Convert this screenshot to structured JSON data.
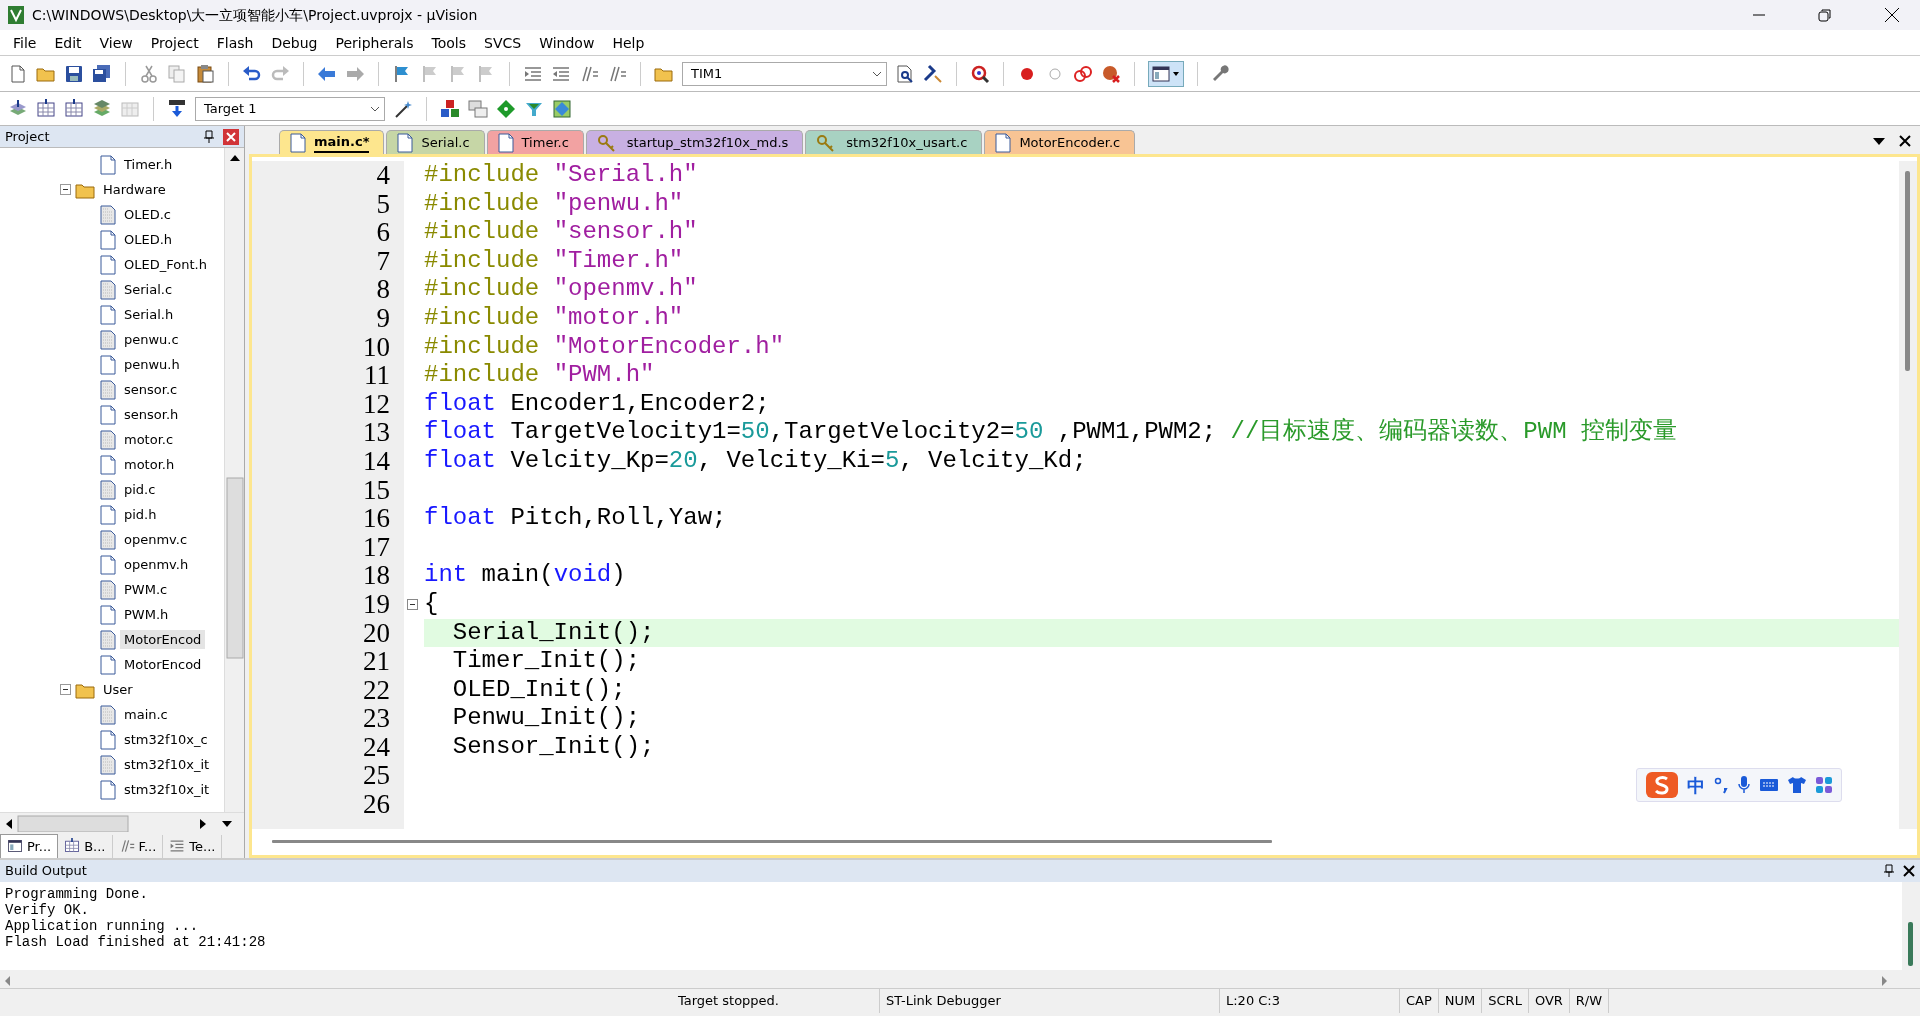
{
  "window": {
    "title": "C:\\WINDOWS\\Desktop\\大一立项智能小车\\Project.uvprojx - µVision"
  },
  "menu": [
    "File",
    "Edit",
    "View",
    "Project",
    "Flash",
    "Debug",
    "Peripherals",
    "Tools",
    "SVCS",
    "Window",
    "Help"
  ],
  "toolbar": {
    "find_value": "TIM1",
    "target": "Target 1"
  },
  "project_panel": {
    "title": "Project",
    "tree": [
      {
        "kind": "header",
        "label": "Timer.h",
        "selected": false
      },
      {
        "kind": "folder",
        "label": "Hardware",
        "expanded": true,
        "selected": false,
        "children": [
          {
            "kind": "source",
            "label": "OLED.c",
            "selected": false
          },
          {
            "kind": "header",
            "label": "OLED.h",
            "selected": false
          },
          {
            "kind": "header",
            "label": "OLED_Font.h",
            "selected": false
          },
          {
            "kind": "source",
            "label": "Serial.c",
            "selected": false
          },
          {
            "kind": "header",
            "label": "Serial.h",
            "selected": false
          },
          {
            "kind": "source",
            "label": "penwu.c",
            "selected": false
          },
          {
            "kind": "header",
            "label": "penwu.h",
            "selected": false
          },
          {
            "kind": "source",
            "label": "sensor.c",
            "selected": false
          },
          {
            "kind": "header",
            "label": "sensor.h",
            "selected": false
          },
          {
            "kind": "source",
            "label": "motor.c",
            "selected": false
          },
          {
            "kind": "header",
            "label": "motor.h",
            "selected": false
          },
          {
            "kind": "source",
            "label": "pid.c",
            "selected": false
          },
          {
            "kind": "header",
            "label": "pid.h",
            "selected": false
          },
          {
            "kind": "source",
            "label": "openmv.c",
            "selected": false
          },
          {
            "kind": "header",
            "label": "openmv.h",
            "selected": false
          },
          {
            "kind": "source",
            "label": "PWM.c",
            "selected": false
          },
          {
            "kind": "header",
            "label": "PWM.h",
            "selected": false
          },
          {
            "kind": "source",
            "label": "MotorEncod",
            "selected": true
          },
          {
            "kind": "header",
            "label": "MotorEncod",
            "selected": false
          }
        ]
      },
      {
        "kind": "folder",
        "label": "User",
        "expanded": true,
        "selected": false,
        "children": [
          {
            "kind": "source",
            "label": "main.c",
            "selected": false
          },
          {
            "kind": "header",
            "label": "stm32f10x_c",
            "selected": false
          },
          {
            "kind": "source",
            "label": "stm32f10x_it",
            "selected": false
          },
          {
            "kind": "header",
            "label": "stm32f10x_it",
            "selected": false
          }
        ]
      }
    ],
    "tabs": [
      {
        "label": "Pr...",
        "selected": true
      },
      {
        "label": "B...",
        "selected": false
      },
      {
        "label": "F...",
        "selected": false
      },
      {
        "label": "Te...",
        "selected": false
      }
    ]
  },
  "editor": {
    "tabs": [
      {
        "label": "main.c*",
        "selected": true,
        "kind": "file",
        "color": "#fde68e"
      },
      {
        "label": "Serial.c",
        "selected": false,
        "kind": "file",
        "color": "#c6d6a6"
      },
      {
        "label": "Timer.c",
        "selected": false,
        "kind": "file",
        "color": "#f2a2a2"
      },
      {
        "label": "startup_stm32f10x_md.s",
        "selected": false,
        "kind": "key",
        "color": "#c8b0e2"
      },
      {
        "label": "stm32f10x_usart.c",
        "selected": false,
        "kind": "key",
        "color": "#a8d2c2"
      },
      {
        "label": "MotorEncoder.c",
        "selected": false,
        "kind": "file",
        "color": "#f8c494"
      }
    ],
    "lines": [
      {
        "number": "4",
        "current": false,
        "fold": false,
        "tokens": [
          {
            "kind": "pp",
            "text": "#include "
          },
          {
            "kind": "str",
            "text": "\"Serial.h\""
          }
        ]
      },
      {
        "number": "5",
        "current": false,
        "fold": false,
        "tokens": [
          {
            "kind": "pp",
            "text": "#include "
          },
          {
            "kind": "str",
            "text": "\"penwu.h\""
          }
        ]
      },
      {
        "number": "6",
        "current": false,
        "fold": false,
        "tokens": [
          {
            "kind": "pp",
            "text": "#include "
          },
          {
            "kind": "str",
            "text": "\"sensor.h\""
          }
        ]
      },
      {
        "number": "7",
        "current": false,
        "fold": false,
        "tokens": [
          {
            "kind": "pp",
            "text": "#include "
          },
          {
            "kind": "str",
            "text": "\"Timer.h\""
          }
        ]
      },
      {
        "number": "8",
        "current": false,
        "fold": false,
        "tokens": [
          {
            "kind": "pp",
            "text": "#include "
          },
          {
            "kind": "str",
            "text": "\"openmv.h\""
          }
        ]
      },
      {
        "number": "9",
        "current": false,
        "fold": false,
        "tokens": [
          {
            "kind": "pp",
            "text": "#include "
          },
          {
            "kind": "str",
            "text": "\"motor.h\""
          }
        ]
      },
      {
        "number": "10",
        "current": false,
        "fold": false,
        "tokens": [
          {
            "kind": "pp",
            "text": "#include "
          },
          {
            "kind": "str",
            "text": "\"MotorEncoder.h\""
          }
        ]
      },
      {
        "number": "11",
        "current": false,
        "fold": false,
        "tokens": [
          {
            "kind": "pp",
            "text": "#include "
          },
          {
            "kind": "str",
            "text": "\"PWM.h\""
          }
        ]
      },
      {
        "number": "12",
        "current": false,
        "fold": false,
        "tokens": [
          {
            "kind": "kw",
            "text": "float"
          },
          {
            "kind": "plain",
            "text": " Encoder1,Encoder2;"
          }
        ]
      },
      {
        "number": "13",
        "current": false,
        "fold": false,
        "tokens": [
          {
            "kind": "kw",
            "text": "float"
          },
          {
            "kind": "plain",
            "text": " TargetVelocity1="
          },
          {
            "kind": "num",
            "text": "50"
          },
          {
            "kind": "plain",
            "text": ",TargetVelocity2="
          },
          {
            "kind": "num",
            "text": "50"
          },
          {
            "kind": "plain",
            "text": " ,PWM1,PWM2; "
          },
          {
            "kind": "cmt",
            "text": "//目标速度、编码器读数、PWM 控制变量"
          }
        ]
      },
      {
        "number": "14",
        "current": false,
        "fold": false,
        "tokens": [
          {
            "kind": "kw",
            "text": "float"
          },
          {
            "kind": "plain",
            "text": " Velcity_Kp="
          },
          {
            "kind": "num",
            "text": "20"
          },
          {
            "kind": "plain",
            "text": ", Velcity_Ki="
          },
          {
            "kind": "num",
            "text": "5"
          },
          {
            "kind": "plain",
            "text": ", Velcity_Kd;"
          }
        ]
      },
      {
        "number": "15",
        "current": false,
        "fold": false
      },
      {
        "number": "16",
        "current": false,
        "fold": false,
        "tokens": [
          {
            "kind": "kw",
            "text": "float"
          },
          {
            "kind": "plain",
            "text": " Pitch,Roll,Yaw;"
          }
        ]
      },
      {
        "number": "17",
        "current": false,
        "fold": false
      },
      {
        "number": "18",
        "current": false,
        "fold": false,
        "tokens": [
          {
            "kind": "kw",
            "text": "int"
          },
          {
            "kind": "plain",
            "text": " main("
          },
          {
            "kind": "kw",
            "text": "void"
          },
          {
            "kind": "plain",
            "text": ")"
          }
        ]
      },
      {
        "number": "19",
        "current": false,
        "fold": true,
        "tokens": [
          {
            "kind": "plain",
            "text": "{"
          }
        ]
      },
      {
        "number": "20",
        "current": true,
        "fold": false,
        "tokens": [
          {
            "kind": "plain",
            "text": "  Serial_Init();"
          }
        ]
      },
      {
        "number": "21",
        "current": false,
        "fold": false,
        "tokens": [
          {
            "kind": "plain",
            "text": "  Timer_Init();"
          }
        ]
      },
      {
        "number": "22",
        "current": false,
        "fold": false,
        "tokens": [
          {
            "kind": "plain",
            "text": "  OLED_Init();"
          }
        ]
      },
      {
        "number": "23",
        "current": false,
        "fold": false,
        "tokens": [
          {
            "kind": "plain",
            "text": "  Penwu_Init();"
          }
        ]
      },
      {
        "number": "24",
        "current": false,
        "fold": false,
        "tokens": [
          {
            "kind": "plain",
            "text": "  Sensor_Init();"
          }
        ]
      },
      {
        "number": "25",
        "current": false,
        "fold": false
      },
      {
        "number": "26",
        "current": false,
        "fold": false
      }
    ]
  },
  "ime": {
    "label": "中"
  },
  "build_output": {
    "title": "Build Output",
    "lines": [
      "Programming Done.",
      "Verify OK.",
      "Application running ...",
      "Flash Load finished at 21:41:28"
    ]
  },
  "status_bar": {
    "items": [
      "Target stopped.",
      "ST-Link Debugger",
      "L:20 C:3",
      "CAP",
      "NUM",
      "SCRL",
      "OVR",
      "R/W"
    ]
  }
}
